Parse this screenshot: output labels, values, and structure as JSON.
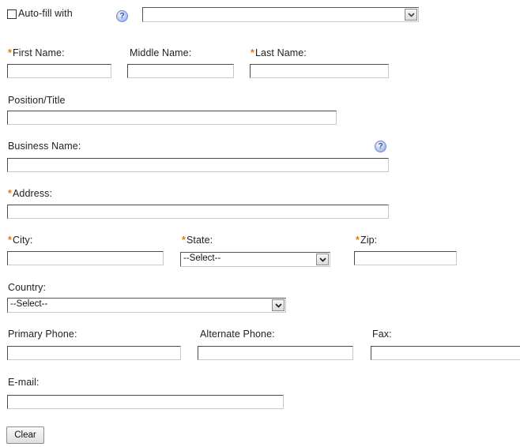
{
  "autofill": {
    "label": "Auto-fill with",
    "selected": "",
    "help_icon": "?"
  },
  "fields": {
    "first_name": {
      "label": "First Name:",
      "required": "*",
      "value": ""
    },
    "middle_name": {
      "label": "Middle Name:",
      "value": ""
    },
    "last_name": {
      "label": "Last Name:",
      "required": "*",
      "value": ""
    },
    "position": {
      "label": "Position/Title",
      "value": ""
    },
    "business": {
      "label": "Business Name:",
      "value": "",
      "help_icon": "?"
    },
    "address": {
      "label": "Address:",
      "required": "*",
      "value": ""
    },
    "city": {
      "label": "City:",
      "required": "*",
      "value": ""
    },
    "state": {
      "label": "State:",
      "required": "*",
      "selected": "--Select--"
    },
    "zip": {
      "label": "Zip:",
      "required": "*",
      "value": ""
    },
    "country": {
      "label": "Country:",
      "selected": "--Select--"
    },
    "primary_phone": {
      "label": "Primary Phone:",
      "value": ""
    },
    "alternate_phone": {
      "label": "Alternate Phone:",
      "value": ""
    },
    "fax": {
      "label": "Fax:",
      "value": ""
    },
    "email": {
      "label": "E-mail:",
      "value": ""
    }
  },
  "buttons": {
    "clear": "Clear"
  }
}
